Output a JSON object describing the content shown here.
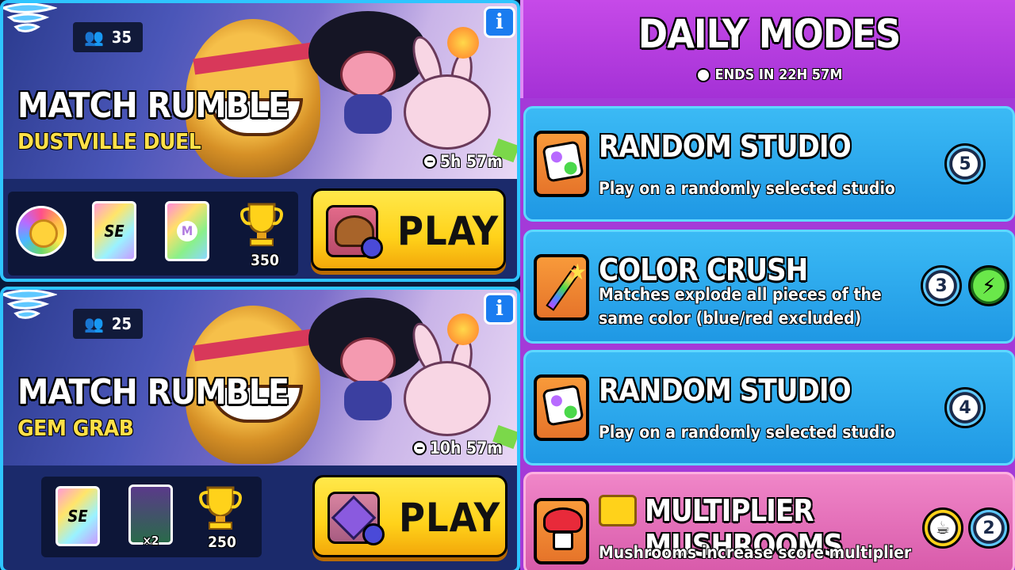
{
  "events": [
    {
      "players": "35",
      "title": "MATCH RUMBLE",
      "subtitle": "DUSTVILLE DUEL",
      "timer": "5h 57m",
      "play_label": "PLAY",
      "trophy_count": "350",
      "rewards": [
        "color-wheel",
        "se-card",
        "m-card",
        "trophy"
      ]
    },
    {
      "players": "25",
      "title": "MATCH RUMBLE",
      "subtitle": "GEM GRAB",
      "timer": "10h 57m",
      "play_label": "PLAY",
      "pack_count": "×2",
      "trophy_count": "250",
      "rewards": [
        "se-card",
        "card-pack",
        "trophy"
      ]
    }
  ],
  "daily": {
    "title": "DAILY MODES",
    "ends": "ENDS IN 22H 57M",
    "modes": [
      {
        "name": "RANDOM STUDIO",
        "desc": "Play on a randomly selected studio",
        "counter": "5"
      },
      {
        "name": "COLOR CRUSH",
        "desc": "Matches explode all pieces of the same color (blue/red excluded)",
        "counter": "3"
      },
      {
        "name": "RANDOM STUDIO",
        "desc": "Play on a randomly selected studio",
        "counter": "4"
      },
      {
        "name": "MULTIPLIER MUSHROOMS",
        "desc": "Mushrooms increase score multiplier",
        "counter": "2"
      }
    ]
  },
  "info_label": "i"
}
